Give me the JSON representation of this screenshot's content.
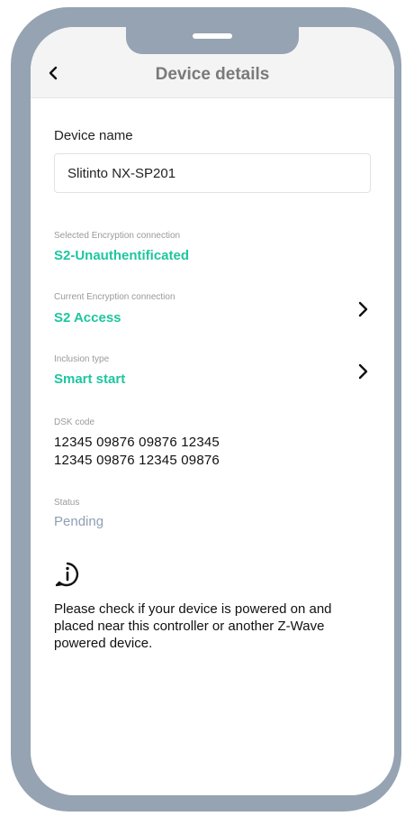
{
  "header": {
    "title": "Device details",
    "back_icon": "chevron-left-icon"
  },
  "device_name": {
    "label": "Device name",
    "value": "Slitinto NX-SP201"
  },
  "selected_encryption": {
    "label": "Selected Encryption connection",
    "value": "S2-Unauthentificated"
  },
  "current_encryption": {
    "label": "Current Encryption connection",
    "value": "S2 Access",
    "icon": "chevron-right-icon"
  },
  "inclusion_type": {
    "label": "Inclusion type",
    "value": "Smart start",
    "icon": "chevron-right-icon"
  },
  "dsk": {
    "label": "DSK code",
    "line1": "12345 09876 09876 12345",
    "line2": "12345 09876 12345 09876"
  },
  "status": {
    "label": "Status",
    "value": "Pending"
  },
  "info": {
    "icon": "info-icon",
    "message": "Please check if your device is powered on and placed near this controller or another Z-Wave powered device."
  },
  "colors": {
    "accent_green": "#1ec6a0",
    "status_blue_gray": "#8ea0b5",
    "frame_gray": "#95a3b2"
  }
}
